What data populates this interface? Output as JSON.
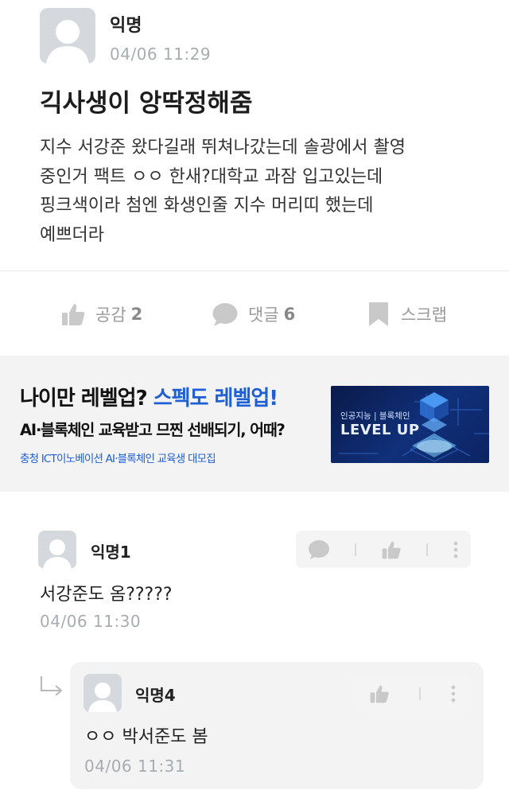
{
  "post": {
    "author": "익명",
    "time": "04/06 11:29",
    "title": "긱사생이 앙딱정해줌",
    "body": "지수 서강준 왔다길래 뛰쳐나갔는데 솔광에서 촬영\n중인거 팩트 ㅇㅇ 한새?대학교 과잠 입고있는데\n핑크색이라 첨엔 화생인줄 지수 머리띠 했는데\n예쁘더라"
  },
  "actions": {
    "like_label": "공감",
    "like_count": "2",
    "comment_label": "댓글",
    "comment_count": "6",
    "scrap_label": "스크랩"
  },
  "ad": {
    "headline_main": "나이만 레벨업?",
    "headline_accent": "스펙도 레벨업!",
    "subline": "AI·블록체인 교육받고 므찐 선배되기, 어때?",
    "footer": "충청 ICT이노베이션 AI·블록체인 교육생 대모집",
    "image_small": "인공지능 | 블록체인",
    "image_big": "LEVEL UP"
  },
  "comments": [
    {
      "author": "익명1",
      "body": "서강준도 옴?????",
      "time": "04/06 11:30",
      "replies": [
        {
          "author": "익명4",
          "body": "ㅇㅇ 박서준도 봄",
          "time": "04/06 11:31"
        }
      ]
    }
  ],
  "colors": {
    "accent": "#1e5fd6",
    "muted_text": "#a8acb1",
    "icon_gray": "#c9c9c9",
    "ad_background": "#f3f3f3"
  }
}
